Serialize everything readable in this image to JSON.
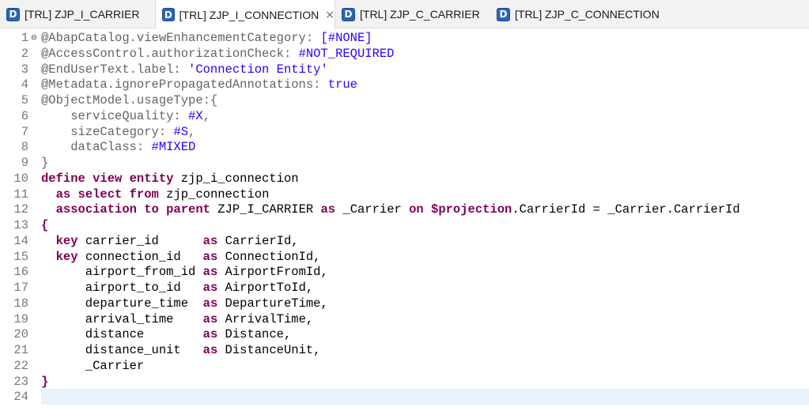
{
  "tabs": [
    {
      "icon": "D",
      "label": "[TRL] ZJP_I_CARRIER",
      "active": false
    },
    {
      "icon": "D",
      "label": "[TRL] ZJP_I_CONNECTION",
      "active": true,
      "close": "×"
    },
    {
      "icon": "D",
      "label": "[TRL] ZJP_C_CARRIER",
      "active": false
    },
    {
      "icon": "D",
      "label": "[TRL] ZJP_C_CONNECTION",
      "active": false
    }
  ],
  "editor": {
    "fold_marker": "⊖",
    "lines": [
      {
        "n": "1",
        "t": [
          [
            "@AbapCatalog.viewEnhancementCategory: ",
            "an"
          ],
          [
            "[#NONE]",
            "av"
          ]
        ]
      },
      {
        "n": "2",
        "t": [
          [
            "@AccessControl.authorizationCheck: ",
            "an"
          ],
          [
            "#NOT_REQUIRED",
            "av"
          ]
        ]
      },
      {
        "n": "3",
        "t": [
          [
            "@EndUserText.label: ",
            "an"
          ],
          [
            "'Connection Entity'",
            "st"
          ]
        ]
      },
      {
        "n": "4",
        "t": [
          [
            "@Metadata.ignorePropagatedAnnotations: ",
            "an"
          ],
          [
            "true",
            "av"
          ]
        ]
      },
      {
        "n": "5",
        "t": [
          [
            "@ObjectModel.usageType:{",
            "an"
          ]
        ]
      },
      {
        "n": "6",
        "t": [
          [
            "    serviceQuality: ",
            "an"
          ],
          [
            "#X",
            "av"
          ],
          [
            ",",
            "an"
          ]
        ]
      },
      {
        "n": "7",
        "t": [
          [
            "    sizeCategory: ",
            "an"
          ],
          [
            "#S",
            "av"
          ],
          [
            ",",
            "an"
          ]
        ]
      },
      {
        "n": "8",
        "t": [
          [
            "    dataClass: ",
            "an"
          ],
          [
            "#MIXED",
            "av"
          ]
        ]
      },
      {
        "n": "9",
        "t": [
          [
            "}",
            "an"
          ]
        ]
      },
      {
        "n": "10",
        "t": [
          [
            "define view entity",
            "kw"
          ],
          [
            " zjp_i_connection",
            "tx"
          ]
        ]
      },
      {
        "n": "11",
        "t": [
          [
            "  ",
            "tx"
          ],
          [
            "as select from",
            "kw"
          ],
          [
            " zjp_connection",
            "tx"
          ]
        ]
      },
      {
        "n": "12",
        "t": [
          [
            "  ",
            "tx"
          ],
          [
            "association to parent",
            "kw"
          ],
          [
            " ZJP_I_CARRIER ",
            "tx"
          ],
          [
            "as",
            "kw"
          ],
          [
            " _Carrier ",
            "tx"
          ],
          [
            "on",
            "kw"
          ],
          [
            " ",
            "tx"
          ],
          [
            "$projection",
            "kw"
          ],
          [
            ".CarrierId = _Carrier.CarrierId",
            "tx"
          ]
        ]
      },
      {
        "n": "13",
        "t": [
          [
            "{",
            "kw"
          ]
        ]
      },
      {
        "n": "14",
        "t": [
          [
            "  ",
            "tx"
          ],
          [
            "key",
            "kw"
          ],
          [
            " carrier_id      ",
            "tx"
          ],
          [
            "as",
            "kw"
          ],
          [
            " CarrierId,",
            "tx"
          ]
        ]
      },
      {
        "n": "15",
        "t": [
          [
            "  ",
            "tx"
          ],
          [
            "key",
            "kw"
          ],
          [
            " connection_id   ",
            "tx"
          ],
          [
            "as",
            "kw"
          ],
          [
            " ConnectionId,",
            "tx"
          ]
        ]
      },
      {
        "n": "16",
        "t": [
          [
            "      airport_from_id ",
            "tx"
          ],
          [
            "as",
            "kw"
          ],
          [
            " AirportFromId,",
            "tx"
          ]
        ]
      },
      {
        "n": "17",
        "t": [
          [
            "      airport_to_id   ",
            "tx"
          ],
          [
            "as",
            "kw"
          ],
          [
            " AirportToId,",
            "tx"
          ]
        ]
      },
      {
        "n": "18",
        "t": [
          [
            "      departure_time  ",
            "tx"
          ],
          [
            "as",
            "kw"
          ],
          [
            " DepartureTime,",
            "tx"
          ]
        ]
      },
      {
        "n": "19",
        "t": [
          [
            "      arrival_time    ",
            "tx"
          ],
          [
            "as",
            "kw"
          ],
          [
            " ArrivalTime,",
            "tx"
          ]
        ]
      },
      {
        "n": "20",
        "t": [
          [
            "      distance        ",
            "tx"
          ],
          [
            "as",
            "kw"
          ],
          [
            " Distance,",
            "tx"
          ]
        ]
      },
      {
        "n": "21",
        "t": [
          [
            "      distance_unit   ",
            "tx"
          ],
          [
            "as",
            "kw"
          ],
          [
            " DistanceUnit,",
            "tx"
          ]
        ]
      },
      {
        "n": "22",
        "t": [
          [
            "      _Carrier",
            "tx"
          ]
        ]
      },
      {
        "n": "23",
        "t": [
          [
            "}",
            "kw"
          ]
        ]
      },
      {
        "n": "24",
        "t": []
      }
    ],
    "current_line": "24"
  }
}
